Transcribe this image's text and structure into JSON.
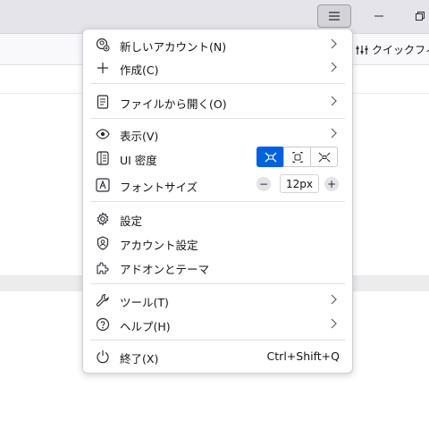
{
  "toolbar": {
    "quick_filter_label": "クイックフィル"
  },
  "menu": {
    "new_account": "新しいアカウント(N)",
    "create": "作成(C)",
    "open_file": "ファイルから開く(O)",
    "view": "表示(V)",
    "ui_density": "UI 密度",
    "font_size": "フォントサイズ",
    "font_size_value": "12px",
    "font_minus": "−",
    "font_plus": "+",
    "settings": "設定",
    "account_settings": "アカウント設定",
    "addons_themes": "アドオンとテーマ",
    "tools": "ツール(T)",
    "help": "ヘルプ(H)",
    "quit": "終了(X)",
    "quit_shortcut": "Ctrl+Shift+Q"
  },
  "colors": {
    "accent": "#0061e0",
    "menu_bg": "#ffffff",
    "titlebar_bg": "#e5e4ea"
  }
}
